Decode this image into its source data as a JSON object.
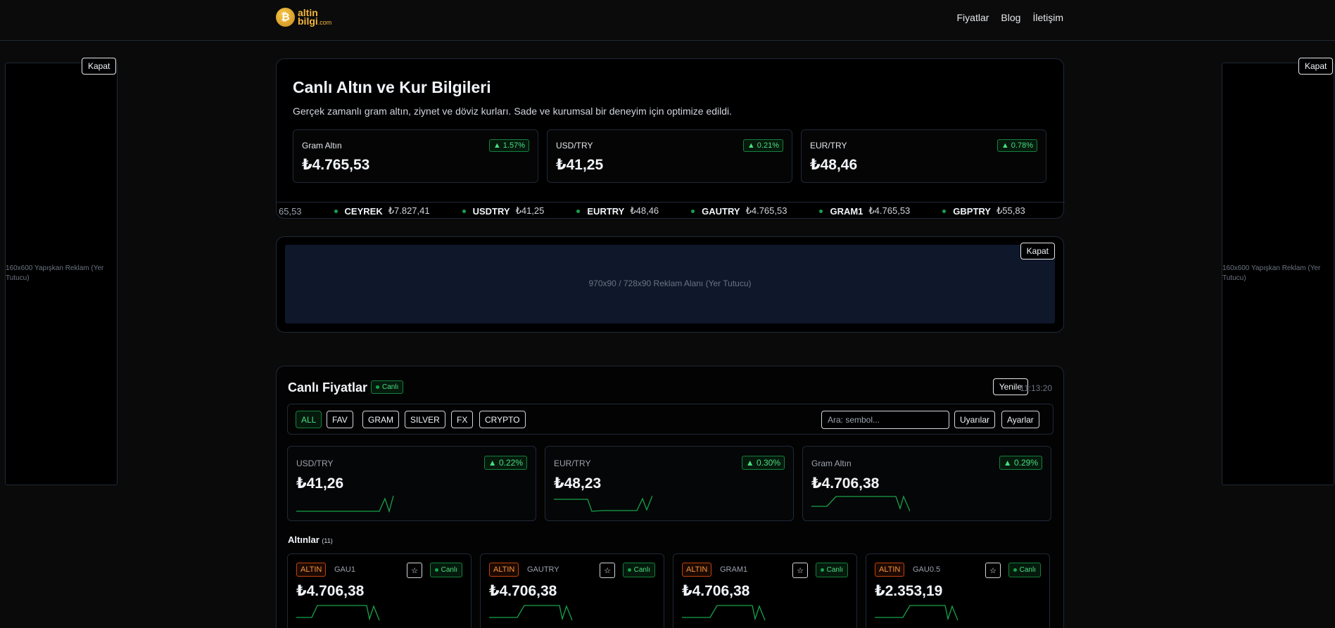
{
  "header": {
    "logo": {
      "line1": "altin",
      "line2": "bilgi",
      "suffix": ".com",
      "coin_glyph": "₿"
    },
    "nav": [
      "Fiyatlar",
      "Blog",
      "İletişim"
    ]
  },
  "side_ads": {
    "close_label": "Kapat",
    "text": "160x600 Yapışkan Reklam (Yer Tutucu)"
  },
  "hero": {
    "title": "Canlı Altın ve Kur Bilgileri",
    "subtitle": "Gerçek zamanlı gram altın, ziynet ve döviz kurları. Sade ve kurumsal bir deneyim için optimize edildi.",
    "cards": [
      {
        "label": "Gram Altın",
        "value": "₺4.765,53",
        "change": "▲ 1.57%"
      },
      {
        "label": "USD/TRY",
        "value": "₺41,25",
        "change": "▲ 0.21%"
      },
      {
        "label": "EUR/TRY",
        "value": "₺48,46",
        "change": "▲ 0.78%"
      }
    ],
    "ticker": {
      "leading_fragment": "65,53",
      "items": [
        {
          "symbol": "CEYREK",
          "price": "₺7.827,41"
        },
        {
          "symbol": "USDTRY",
          "price": "₺41,25"
        },
        {
          "symbol": "EURTRY",
          "price": "₺48,46"
        },
        {
          "symbol": "GAUTRY",
          "price": "₺4.765,53"
        },
        {
          "symbol": "GRAM1",
          "price": "₺4.765,53"
        },
        {
          "symbol": "GBPTRY",
          "price": "₺55,83"
        }
      ]
    }
  },
  "banner_ad": {
    "close_label": "Kapat",
    "text": "970x90 / 728x90 Reklam Alanı (Yer Tutucu)"
  },
  "live": {
    "title": "Canlı Fiyatlar",
    "badge": "Canlı",
    "refresh_label": "Yenile",
    "time": "11:13:20",
    "filters": [
      "ALL",
      "FAV",
      "GRAM",
      "SILVER",
      "FX",
      "CRYPTO"
    ],
    "active_filter": "ALL",
    "search_placeholder": "Ara: sembol...",
    "alerts_label": "Uyarılar",
    "settings_label": "Ayarlar",
    "summary_cards": [
      {
        "label": "USD/TRY",
        "value": "₺41,26",
        "change": "▲ 0.22%"
      },
      {
        "label": "EUR/TRY",
        "value": "₺48,23",
        "change": "▲ 0.30%"
      },
      {
        "label": "Gram Altın",
        "value": "₺4.706,38",
        "change": "▲ 0.29%"
      }
    ],
    "section": {
      "title": "Altınlar",
      "count": "(11)"
    },
    "assets": [
      {
        "tag": "ALTIN",
        "symbol": "GAU1",
        "value": "₺4.706,38",
        "status": "Canlı",
        "star": "☆"
      },
      {
        "tag": "ALTIN",
        "symbol": "GAUTRY",
        "value": "₺4.706,38",
        "status": "Canlı",
        "star": "☆"
      },
      {
        "tag": "ALTIN",
        "symbol": "GRAM1",
        "value": "₺4.706,38",
        "status": "Canlı",
        "star": "☆"
      },
      {
        "tag": "ALTIN",
        "symbol": "GAU0.5",
        "value": "₺2.353,19",
        "status": "Canlı",
        "star": "☆"
      }
    ]
  },
  "colors": {
    "accent_green": "#4ade80",
    "tag_orange": "#fb923c",
    "brand_gold": "#f5b73b"
  }
}
